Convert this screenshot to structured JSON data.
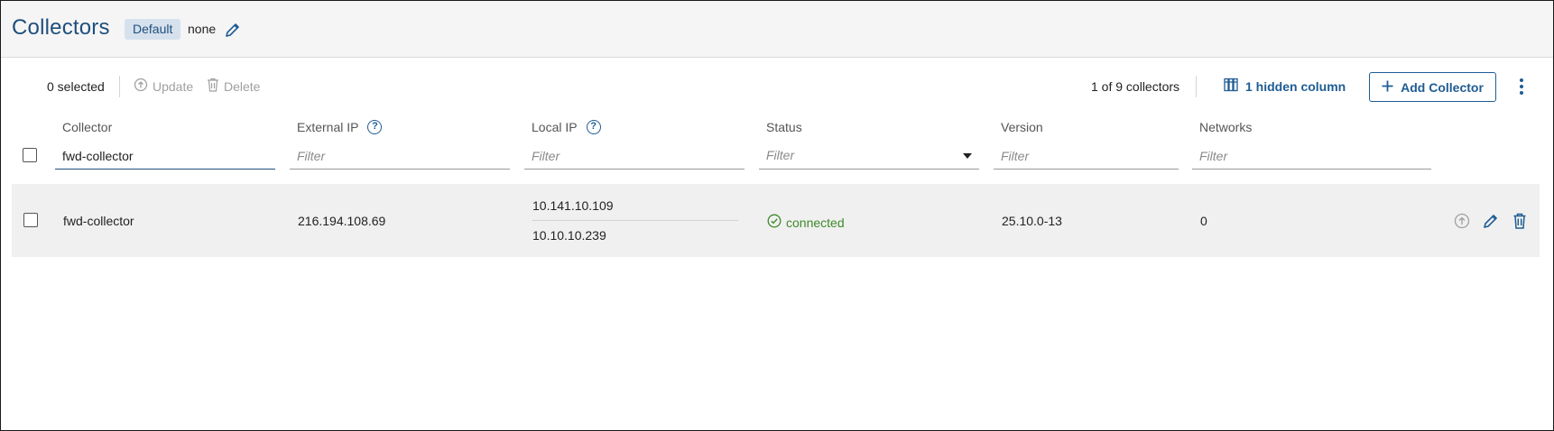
{
  "header": {
    "title": "Collectors",
    "tag_label": "Default",
    "tag_value": "none"
  },
  "toolbar": {
    "selected_count": "0 selected",
    "update_label": "Update",
    "delete_label": "Delete",
    "count_text": "1 of 9 collectors",
    "hidden_columns_label": "1 hidden column",
    "add_label": "Add Collector"
  },
  "columns": [
    {
      "label": "Collector",
      "filter_value": "fwd-collector",
      "filter_placeholder": "Filter"
    },
    {
      "label": "External IP",
      "filter_value": "",
      "filter_placeholder": "Filter"
    },
    {
      "label": "Local IP",
      "filter_value": "",
      "filter_placeholder": "Filter"
    },
    {
      "label": "Status",
      "filter_value": "",
      "filter_placeholder": "Filter"
    },
    {
      "label": "Version",
      "filter_value": "",
      "filter_placeholder": "Filter"
    },
    {
      "label": "Networks",
      "filter_value": "",
      "filter_placeholder": "Filter"
    }
  ],
  "rows": [
    {
      "collector": "fwd-collector",
      "external_ip": "216.194.108.69",
      "local_ips": [
        "10.141.10.109",
        "10.10.10.239"
      ],
      "status": "connected",
      "version": "25.10.0-13",
      "networks": "0"
    }
  ],
  "colors": {
    "accent": "#1f5c93",
    "title": "#1f4f7c",
    "status_connected": "#3d8a2a",
    "disabled": "#a0a0a0",
    "row_bg": "#f0f0f0"
  },
  "icons": [
    "pencil-icon",
    "upload-icon",
    "trash-icon",
    "columns-icon",
    "plus-icon",
    "kebab-icon",
    "help-icon",
    "check-circle-icon",
    "chevron-down-icon"
  ]
}
